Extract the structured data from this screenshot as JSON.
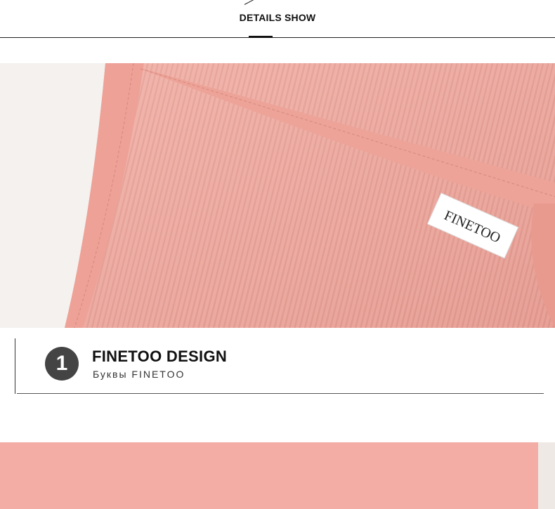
{
  "header": {
    "title": "DETAILS SHOW"
  },
  "detail_photo": {
    "label_text": "FINETOO"
  },
  "feature": {
    "number": "1",
    "title": "FINETOO DESIGN",
    "subtitle": "Буквы FINETOO"
  }
}
